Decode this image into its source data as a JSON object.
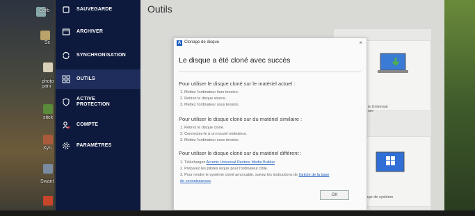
{
  "sidebar": {
    "items": [
      {
        "label": "SAUVEGARDE",
        "icon": "backup-icon"
      },
      {
        "label": "ARCHIVER",
        "icon": "archive-icon"
      },
      {
        "label": "SYNCHRONISATION",
        "icon": "sync-icon"
      },
      {
        "label": "OUTILS",
        "icon": "tools-icon",
        "active": true
      },
      {
        "label": "ACTIVE\nPROTECTION",
        "icon": "shield-icon"
      },
      {
        "label": "COMPTE",
        "icon": "account-icon"
      },
      {
        "label": "PARAMÈTRES",
        "icon": "settings-icon"
      }
    ]
  },
  "main": {
    "title": "Outils",
    "cards": [
      {
        "label": "is Universal\nure",
        "icon": "laptop-icon"
      },
      {
        "label": "tage de système",
        "icon": "windows-icon"
      }
    ]
  },
  "desktop": {
    "labels": [
      "Corb",
      "Sc",
      "photo\npani",
      "stick",
      "Xyn",
      "Swant"
    ]
  },
  "dialog": {
    "app_title": "Clonage de disque",
    "app_icon_letter": "A",
    "heading": "Le disque a été cloné avec succès",
    "sections": [
      {
        "heading": "Pour utiliser le disque cloné sur le matériel actuel :",
        "lines": [
          "1. Mettez l'ordinateur hors tension.",
          "2. Retirez le disque source.",
          "3. Mettez l'ordinateur sous tension."
        ]
      },
      {
        "heading": "Pour utiliser le disque cloné sur du matériel similaire :",
        "lines": [
          "1. Retirez le disque cloné.",
          "2. Connectez-le à un nouvel ordinateur.",
          "3. Mettez l'ordinateur sous tension."
        ]
      },
      {
        "heading": "Pour utiliser le disque cloné sur du matériel différent :",
        "lines": [
          {
            "before": "1. Téléchargez ",
            "link": "Acronis Universal Restore Media Builder",
            "after": "."
          },
          "2. Préparez les pilotes requis pour l'ordinateur cible.",
          {
            "before": "3. Pour rendre le système cloné amorçable, suivez les instructions de ",
            "link": "l'article de la base",
            "after": ""
          },
          {
            "before": "",
            "link": "de connaissances",
            "after": "."
          }
        ]
      }
    ],
    "ok_label": "OK",
    "close_glyph": "×"
  },
  "colors": {
    "sidebar_bg": "#0e1a3d",
    "accent": "#1f5fbf"
  }
}
